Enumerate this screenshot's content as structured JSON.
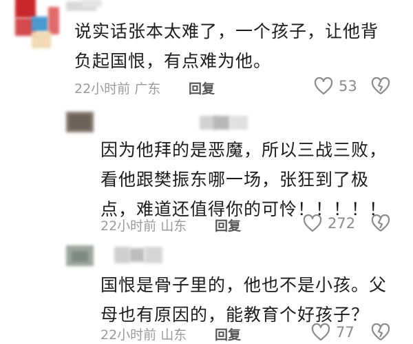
{
  "comments": [
    {
      "text_lines": [
        "说实话张本太难了，一个孩子，让他背",
        "负起国恨，有点难为他。"
      ],
      "time": "22小时前",
      "location": "广东",
      "reply_label": "回复",
      "likes": "53"
    },
    {
      "text_lines": [
        "因为他拜的是恶魔，所以三战三败，",
        "看他跟樊振东哪一场，张狂到了极",
        "点，难道还值得你的可怜！！！！！"
      ],
      "time": "22小时前",
      "location": "山东",
      "reply_label": "回复",
      "likes": "272"
    },
    {
      "text_lines": [
        "国恨是骨子里的，他也不是小孩。父",
        "母也有原因的，能教育个好孩子？"
      ],
      "time": "22小时前",
      "location": "山东",
      "reply_label": "回复",
      "likes": "77"
    }
  ]
}
